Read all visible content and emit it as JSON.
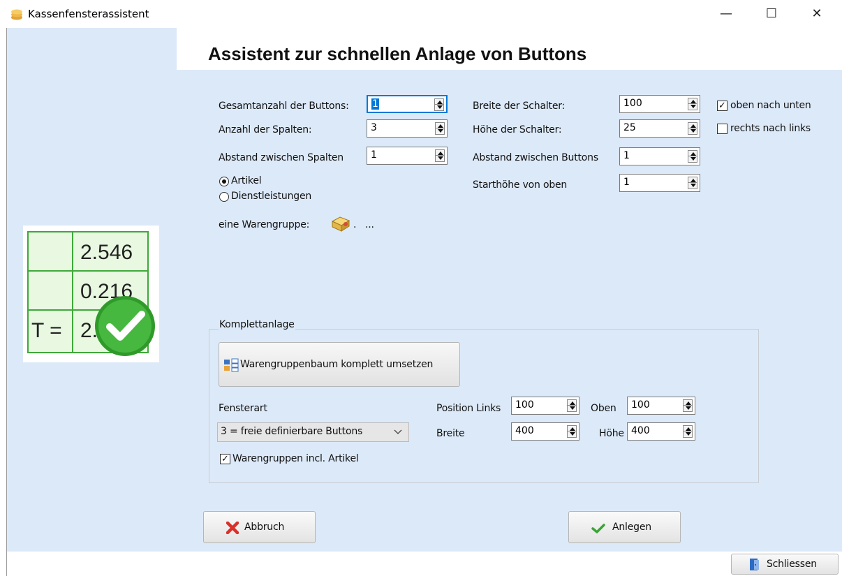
{
  "window": {
    "title": "Kassenfensterassistent",
    "minimize_glyph": "—",
    "maximize_glyph": "☐",
    "close_glyph": "✕"
  },
  "heading": "Assistent zur schnellen Anlage von Buttons",
  "logo": {
    "values": [
      "2.546",
      "0.216",
      "T =",
      "2."
    ]
  },
  "fields": {
    "gesamtanzahl": {
      "label": "Gesamtanzahl der Buttons:",
      "value": "1"
    },
    "spalten": {
      "label": "Anzahl der Spalten:",
      "value": "3"
    },
    "abstand_spalten": {
      "label": "Abstand zwischen Spalten",
      "value": "1"
    },
    "breite": {
      "label": "Breite der Schalter:",
      "value": "100"
    },
    "hoehe": {
      "label": "Höhe der Schalter:",
      "value": "25"
    },
    "abstand_buttons": {
      "label": "Abstand zwischen Buttons",
      "value": "1"
    },
    "starthoehe": {
      "label": "Starthöhe von oben",
      "value": "1"
    }
  },
  "radios": {
    "artikel": {
      "label": "Artikel",
      "selected": true
    },
    "dienstleistungen": {
      "label": "Dienstleistungen",
      "selected": false
    }
  },
  "checkboxes": {
    "oben_nach_unten": {
      "label": "oben nach unten",
      "checked": true
    },
    "rechts_nach_links": {
      "label": "rechts nach links",
      "checked": false
    }
  },
  "warengruppe": {
    "label": "eine Warengruppe:",
    "dot": ".",
    "ellipsis": "..."
  },
  "komplettanlage": {
    "title": "Komplettanlage",
    "button_label": "Warengruppenbaum komplett umsetzen",
    "fensterart_label": "Fensterart",
    "fensterart_value": "3 = freie definierbare Buttons",
    "include_label": "Warengruppen incl. Artikel",
    "include_checked": true,
    "position_links_label": "Position Links",
    "position_links_value": "100",
    "oben_label": "Oben",
    "oben_value": "100",
    "breite_label": "Breite",
    "breite_value": "400",
    "hoehe_label": "Höhe",
    "hoehe_value": "400"
  },
  "buttons": {
    "abbruch": "Abbruch",
    "anlegen": "Anlegen",
    "schliessen": "Schliessen"
  },
  "colors": {
    "panel": "#dce9f8",
    "focus": "#0078d7",
    "cancel_red": "#d8312a",
    "ok_green": "#3aa535"
  }
}
